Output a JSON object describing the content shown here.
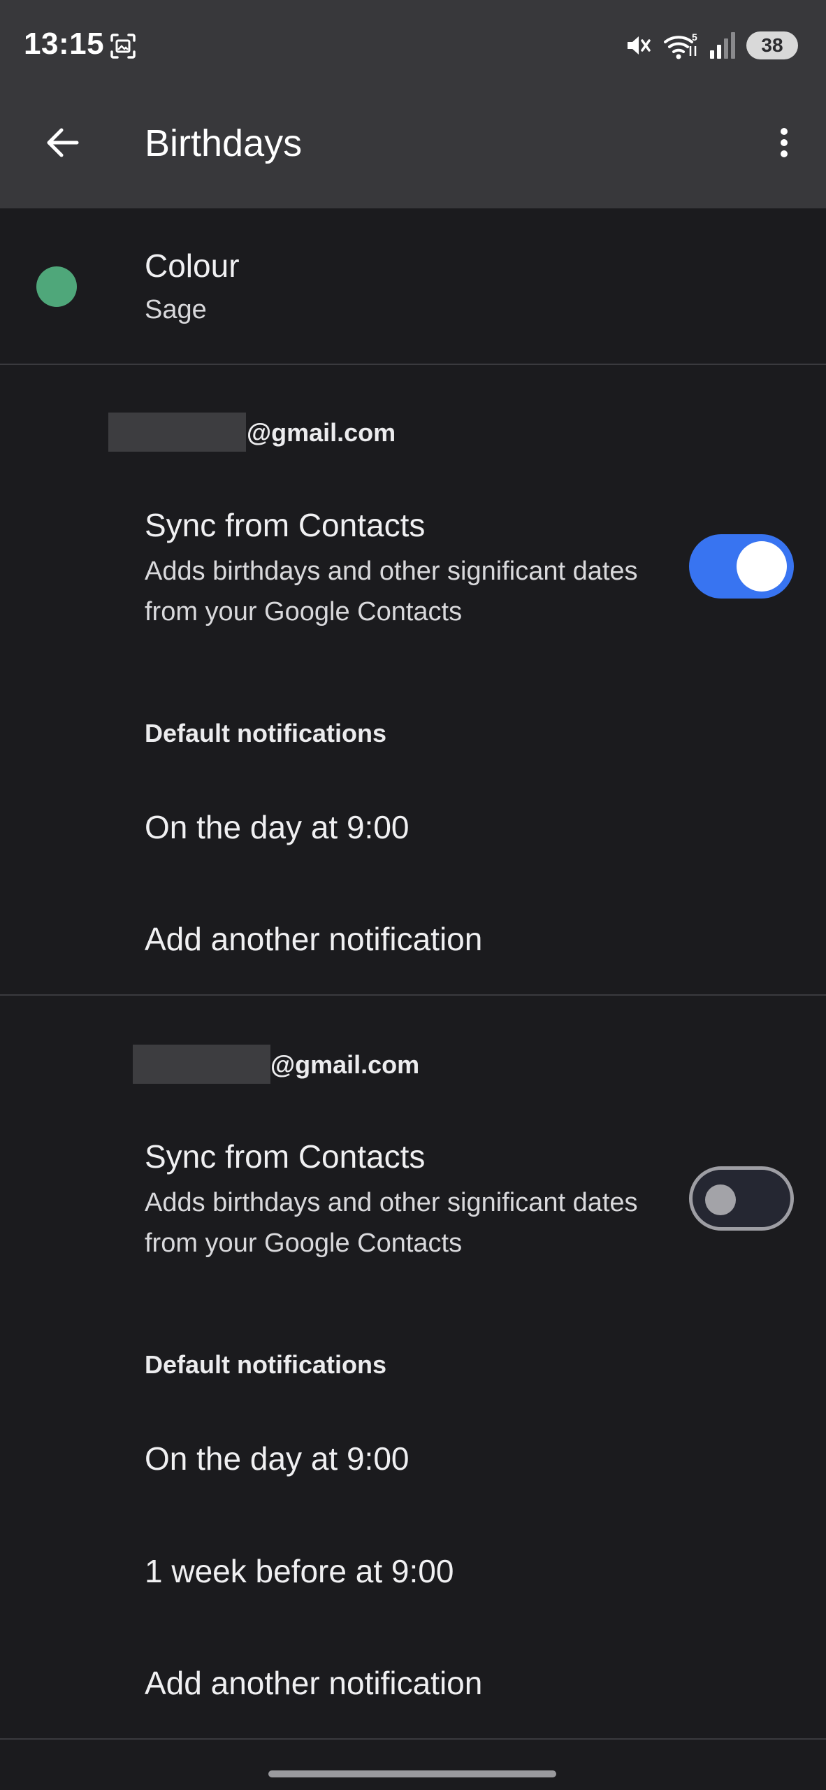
{
  "status_bar": {
    "time": "13:15",
    "battery": "38",
    "icons": [
      "screenshot-icon",
      "mute-icon",
      "wifi-icon",
      "signal-icon",
      "battery-icon"
    ]
  },
  "app_bar": {
    "title": "Birthdays",
    "icons": [
      "back-arrow-icon",
      "more-vert-icon"
    ]
  },
  "colour": {
    "label": "Colour",
    "value": "Sage",
    "swatch_color": "#4fa77a"
  },
  "accounts": [
    {
      "email_suffix": "@gmail.com",
      "sync_title": "Sync from Contacts",
      "sync_desc": "Adds birthdays and other significant dates from your Google Contacts",
      "sync_enabled": true,
      "notifications_header": "Default notifications",
      "notifications": [
        "On the day at 9:00"
      ],
      "add_notification": "Add another notification"
    },
    {
      "email_suffix": "@gmail.com",
      "sync_title": "Sync from Contacts",
      "sync_desc": "Adds birthdays and other significant dates from your Google Contacts",
      "sync_enabled": false,
      "notifications_header": "Default notifications",
      "notifications": [
        "On the day at 9:00",
        "1 week before at 9:00"
      ],
      "add_notification": "Add another notification"
    }
  ],
  "colors": {
    "background": "#1b1b1e",
    "app_bar": "#38383b",
    "toggle_on": "#3874f1",
    "divider": "#3a3a3e"
  }
}
